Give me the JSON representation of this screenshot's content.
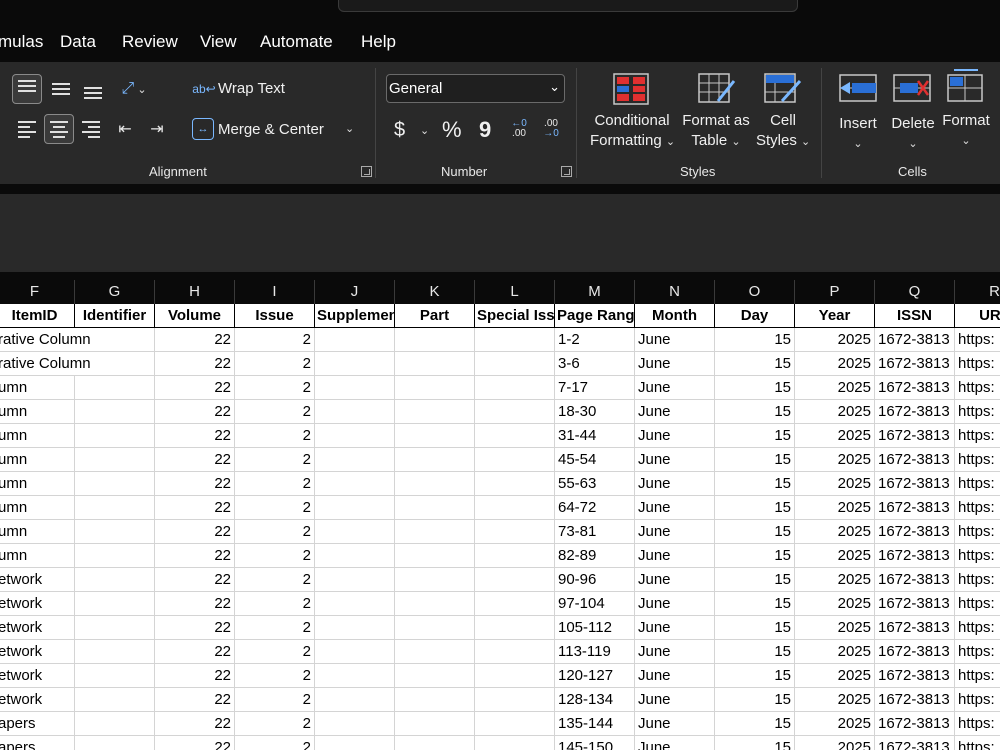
{
  "menu": [
    "mulas",
    "Data",
    "Review",
    "View",
    "Automate",
    "Help"
  ],
  "ribbon": {
    "alignment": {
      "label": "Alignment",
      "wrap_text": "Wrap Text",
      "merge_center": "Merge & Center"
    },
    "number": {
      "label": "Number",
      "format": "General",
      "currency_symbol": "$",
      "percent_symbol": "%",
      "comma_symbol": "9"
    },
    "styles": {
      "label": "Styles",
      "conditional_line1": "Conditional",
      "conditional_line2": "Formatting",
      "format_table_line1": "Format as",
      "format_table_line2": "Table",
      "cell_styles_line1": "Cell",
      "cell_styles_line2": "Styles"
    },
    "cells": {
      "label": "Cells",
      "insert": "Insert",
      "delete": "Delete",
      "format": "Format"
    }
  },
  "columns": [
    "F",
    "G",
    "H",
    "I",
    "J",
    "K",
    "L",
    "M",
    "N",
    "O",
    "P",
    "Q",
    "R"
  ],
  "headers": [
    "ItemID",
    "Identifier",
    "Volume",
    "Issue",
    "Supplement",
    "Part",
    "Special Issue",
    "Page Range",
    "Month",
    "Day",
    "Year",
    "ISSN",
    "URL"
  ],
  "rows": [
    [
      "rative Column",
      "",
      "22",
      "2",
      "",
      "",
      "",
      "1-2",
      "June",
      "15",
      "2025",
      "1672-3813",
      "https:"
    ],
    [
      "rative Column",
      "",
      "22",
      "2",
      "",
      "",
      "",
      "3-6",
      "June",
      "15",
      "2025",
      "1672-3813",
      "https:"
    ],
    [
      "umn",
      "",
      "22",
      "2",
      "",
      "",
      "",
      "7-17",
      "June",
      "15",
      "2025",
      "1672-3813",
      "https:"
    ],
    [
      "umn",
      "",
      "22",
      "2",
      "",
      "",
      "",
      "18-30",
      "June",
      "15",
      "2025",
      "1672-3813",
      "https:"
    ],
    [
      "umn",
      "",
      "22",
      "2",
      "",
      "",
      "",
      "31-44",
      "June",
      "15",
      "2025",
      "1672-3813",
      "https:"
    ],
    [
      "umn",
      "",
      "22",
      "2",
      "",
      "",
      "",
      "45-54",
      "June",
      "15",
      "2025",
      "1672-3813",
      "https:"
    ],
    [
      "umn",
      "",
      "22",
      "2",
      "",
      "",
      "",
      "55-63",
      "June",
      "15",
      "2025",
      "1672-3813",
      "https:"
    ],
    [
      "umn",
      "",
      "22",
      "2",
      "",
      "",
      "",
      "64-72",
      "June",
      "15",
      "2025",
      "1672-3813",
      "https:"
    ],
    [
      "umn",
      "",
      "22",
      "2",
      "",
      "",
      "",
      "73-81",
      "June",
      "15",
      "2025",
      "1672-3813",
      "https:"
    ],
    [
      "umn",
      "",
      "22",
      "2",
      "",
      "",
      "",
      "82-89",
      "June",
      "15",
      "2025",
      "1672-3813",
      "https:"
    ],
    [
      "etwork",
      "",
      "22",
      "2",
      "",
      "",
      "",
      "90-96",
      "June",
      "15",
      "2025",
      "1672-3813",
      "https:"
    ],
    [
      "etwork",
      "",
      "22",
      "2",
      "",
      "",
      "",
      "97-104",
      "June",
      "15",
      "2025",
      "1672-3813",
      "https:"
    ],
    [
      "etwork",
      "",
      "22",
      "2",
      "",
      "",
      "",
      "105-112",
      "June",
      "15",
      "2025",
      "1672-3813",
      "https:"
    ],
    [
      "etwork",
      "",
      "22",
      "2",
      "",
      "",
      "",
      "113-119",
      "June",
      "15",
      "2025",
      "1672-3813",
      "https:"
    ],
    [
      "etwork",
      "",
      "22",
      "2",
      "",
      "",
      "",
      "120-127",
      "June",
      "15",
      "2025",
      "1672-3813",
      "https:"
    ],
    [
      "etwork",
      "",
      "22",
      "2",
      "",
      "",
      "",
      "128-134",
      "June",
      "15",
      "2025",
      "1672-3813",
      "https:"
    ],
    [
      "apers",
      "",
      "22",
      "2",
      "",
      "",
      "",
      "135-144",
      "June",
      "15",
      "2025",
      "1672-3813",
      "https:"
    ],
    [
      "apers",
      "",
      "22",
      "2",
      "",
      "",
      "",
      "145-150",
      "June",
      "15",
      "2025",
      "1672-3813",
      "https:"
    ]
  ]
}
